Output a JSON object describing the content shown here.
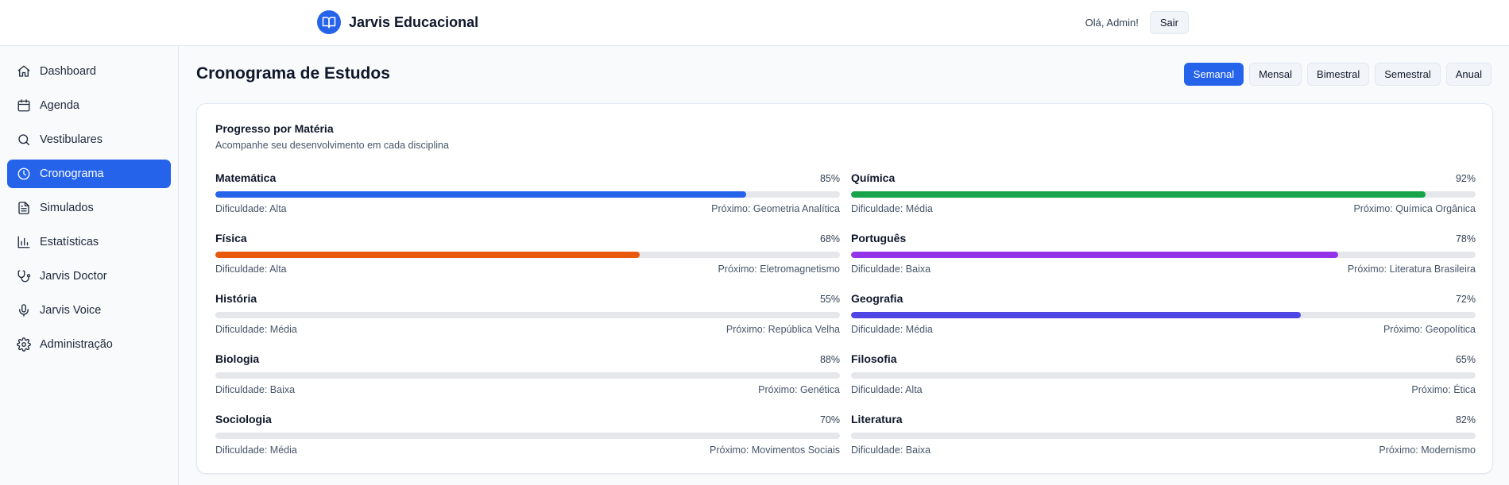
{
  "header": {
    "brand": "Jarvis Educacional",
    "greeting": "Olá, Admin!",
    "logout_label": "Sair"
  },
  "sidebar": {
    "items": [
      {
        "label": "Dashboard",
        "icon": "home-icon",
        "active": false
      },
      {
        "label": "Agenda",
        "icon": "calendar-icon",
        "active": false
      },
      {
        "label": "Vestibulares",
        "icon": "search-icon",
        "active": false
      },
      {
        "label": "Cronograma",
        "icon": "clock-icon",
        "active": true
      },
      {
        "label": "Simulados",
        "icon": "document-icon",
        "active": false
      },
      {
        "label": "Estatísticas",
        "icon": "bar-chart-icon",
        "active": false
      },
      {
        "label": "Jarvis Doctor",
        "icon": "stethoscope-icon",
        "active": false
      },
      {
        "label": "Jarvis Voice",
        "icon": "microphone-icon",
        "active": false
      },
      {
        "label": "Administração",
        "icon": "gear-icon",
        "active": false
      }
    ]
  },
  "main": {
    "title": "Cronograma de Estudos",
    "periods": [
      {
        "label": "Semanal",
        "active": true
      },
      {
        "label": "Mensal",
        "active": false
      },
      {
        "label": "Bimestral",
        "active": false
      },
      {
        "label": "Semestral",
        "active": false
      },
      {
        "label": "Anual",
        "active": false
      }
    ]
  },
  "progress": {
    "title": "Progresso por Matéria",
    "subtitle": "Acompanhe seu desenvolvimento em cada disciplina",
    "subjects": [
      {
        "name": "Matemática",
        "percent": "85%",
        "value": 85,
        "show_fill": true,
        "color": "#2563eb",
        "difficulty": "Dificuldade: Alta",
        "next": "Próximo: Geometria Analítica"
      },
      {
        "name": "Química",
        "percent": "92%",
        "value": 92,
        "show_fill": true,
        "color": "#16a34a",
        "difficulty": "Dificuldade: Média",
        "next": "Próximo: Química Orgânica"
      },
      {
        "name": "Física",
        "percent": "68%",
        "value": 68,
        "show_fill": true,
        "color": "#ea580c",
        "difficulty": "Dificuldade: Alta",
        "next": "Próximo: Eletromagnetismo"
      },
      {
        "name": "Português",
        "percent": "78%",
        "value": 78,
        "show_fill": true,
        "color": "#9333ea",
        "difficulty": "Dificuldade: Baixa",
        "next": "Próximo: Literatura Brasileira"
      },
      {
        "name": "História",
        "percent": "55%",
        "value": 55,
        "show_fill": false,
        "color": "#e5e7eb",
        "difficulty": "Dificuldade: Média",
        "next": "Próximo: República Velha"
      },
      {
        "name": "Geografia",
        "percent": "72%",
        "value": 72,
        "show_fill": true,
        "color": "#4f46e5",
        "difficulty": "Dificuldade: Média",
        "next": "Próximo: Geopolítica"
      },
      {
        "name": "Biologia",
        "percent": "88%",
        "value": 88,
        "show_fill": false,
        "color": "#e5e7eb",
        "difficulty": "Dificuldade: Baixa",
        "next": "Próximo: Genética"
      },
      {
        "name": "Filosofia",
        "percent": "65%",
        "value": 65,
        "show_fill": false,
        "color": "#e5e7eb",
        "difficulty": "Dificuldade: Alta",
        "next": "Próximo: Ética"
      },
      {
        "name": "Sociologia",
        "percent": "70%",
        "value": 70,
        "show_fill": false,
        "color": "#e5e7eb",
        "difficulty": "Dificuldade: Média",
        "next": "Próximo: Movimentos Sociais"
      },
      {
        "name": "Literatura",
        "percent": "82%",
        "value": 82,
        "show_fill": false,
        "color": "#e5e7eb",
        "difficulty": "Dificuldade: Baixa",
        "next": "Próximo: Modernismo"
      }
    ]
  }
}
